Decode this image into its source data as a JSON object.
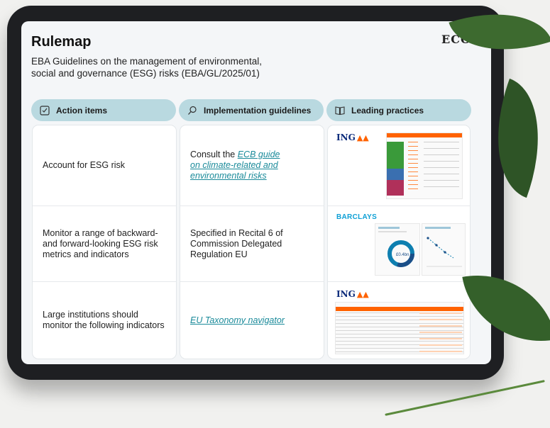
{
  "header": {
    "title": "Rulemap",
    "brand": "ECO.I",
    "subtitle": "EBA Guidelines on the management of environmental, social and governance (ESG) risks (EBA/GL/2025/01)"
  },
  "columns": {
    "action": {
      "label": "Action items",
      "icon": "checkbox-icon"
    },
    "implementation": {
      "label": "Implementation guidelines",
      "icon": "magnifier-doc-icon"
    },
    "practices": {
      "label": "Leading practices",
      "icon": "book-icon"
    }
  },
  "rows": [
    {
      "action": "Account for ESG risk",
      "guideline_prefix": "Consult the ",
      "guideline_link": "ECB guide on climate-related and environmental risks",
      "practice_logo": "ING"
    },
    {
      "action": "Monitor a range of backward-and forward-looking ESG risk metrics and indicators",
      "guideline_text": "Specified in Recital 6 of Commission Delegated Regulation EU",
      "practice_logo": "BARCLAYS",
      "practice_value": "£0.4bn"
    },
    {
      "action": "Large institutions should monitor the following indicators",
      "guideline_link": "EU Taxonomy navigator",
      "practice_logo": "ING"
    }
  ],
  "colors": {
    "header_pill": "#b9d9e0",
    "link": "#1a8a9a",
    "ing_orange": "#ff6200",
    "barclays_blue": "#0ea0d6"
  }
}
